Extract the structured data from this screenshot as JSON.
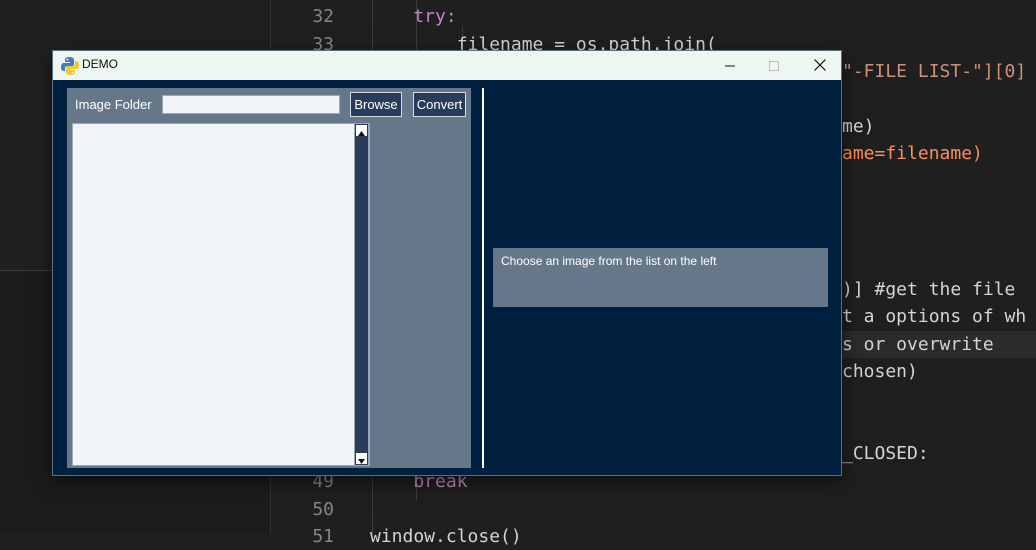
{
  "editor": {
    "lines": [
      {
        "num": "32",
        "code": "    try:"
      },
      {
        "num": "33",
        "code": "        filename = os.path.join("
      },
      {
        "num": "49",
        "code": "    break"
      },
      {
        "num": "50",
        "code": ""
      },
      {
        "num": "51",
        "code": "window.close()"
      }
    ],
    "fragments": {
      "file_list_key": "\"-FILE LIST-\"][0]",
      "name_close": "me)",
      "name_kw": "ame=filename)",
      "comment_get": ")] #get the file",
      "options_text": "t a options of wh",
      "overwrite_text": "s or overwrite",
      "chosen_text": "chosen)",
      "closed_text": "_CLOSED:"
    }
  },
  "window": {
    "title": "DEMO",
    "icons": {
      "app": "python-icon",
      "minimize": "minimize-icon",
      "maximize": "maximize-icon",
      "close": "close-icon"
    }
  },
  "left_column": {
    "folder_label": "Image Folder",
    "folder_value": "",
    "browse_label": "Browse",
    "convert_label": "Convert",
    "file_list": []
  },
  "right_column": {
    "info_text": "Choose an image from the list on the left"
  },
  "colors": {
    "window_bg": "#011f3f",
    "panel_bg": "#667789",
    "button_bg": "#283c5c"
  }
}
